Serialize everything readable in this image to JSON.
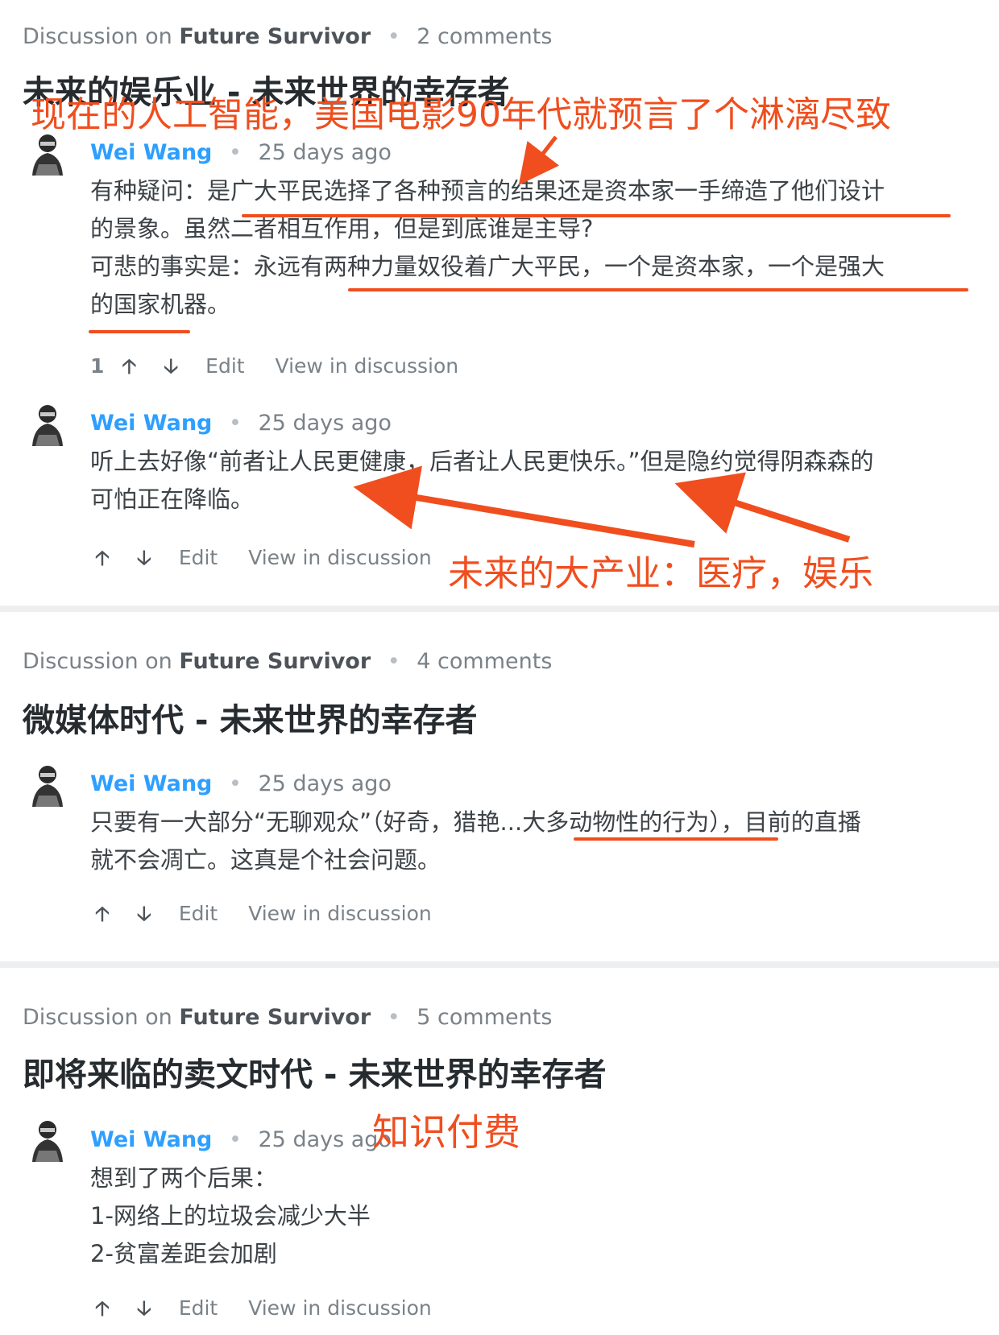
{
  "threads": [
    {
      "meta": {
        "prefix": "Discussion on",
        "forum": "Future Survivor",
        "comments": "2 comments"
      },
      "title": "未来的娱乐业 - 未来世界的幸存者",
      "comments": [
        {
          "author": "Wei Wang",
          "time": "25 days ago",
          "lines": [
            "有种疑问：是广大平民选择了各种预言的结果还是资本家一手缔造了他们设计",
            "的景象。虽然二者相互作用，但是到底谁是主导?",
            "可悲的事实是：永远有两种力量奴役着广大平民，一个是资本家，一个是强大",
            "的国家机器。"
          ],
          "votes": "1",
          "edit": "Edit",
          "view": "View in discussion"
        },
        {
          "author": "Wei Wang",
          "time": "25 days ago",
          "lines": [
            "听上去好像“前者让人民更健康，后者让人民更快乐。”但是隐约觉得阴森森的",
            "可怕正在降临。"
          ],
          "edit": "Edit",
          "view": "View in discussion"
        }
      ]
    },
    {
      "meta": {
        "prefix": "Discussion on",
        "forum": "Future Survivor",
        "comments": "4 comments"
      },
      "title": "微媒体时代 - 未来世界的幸存者",
      "comments": [
        {
          "author": "Wei Wang",
          "time": "25 days ago",
          "lines": [
            "只要有一大部分“无聊观众”（好奇，猎艳...大多动物性的行为），目前的直播",
            "就不会凋亡。这真是个社会问题。"
          ],
          "edit": "Edit",
          "view": "View in discussion"
        }
      ]
    },
    {
      "meta": {
        "prefix": "Discussion on",
        "forum": "Future Survivor",
        "comments": "5 comments"
      },
      "title": "即将来临的卖文时代 - 未来世界的幸存者",
      "comments": [
        {
          "author": "Wei Wang",
          "time": "25 days ago",
          "lines": [
            "想到了两个后果：",
            "1-网络上的垃圾会减少大半",
            "2-贫富差距会加剧"
          ],
          "edit": "Edit",
          "view": "View in discussion"
        }
      ]
    }
  ],
  "annotations": {
    "ai": "现在的人工智能，美国电影90年代就预言了个淋漓尽致",
    "industry": "未来的大产业：医疗，娱乐",
    "paid": "知识付费"
  },
  "colors": {
    "accent": "#2e9fff",
    "annotation": "#f04e1e",
    "divider": "#eceeef"
  }
}
